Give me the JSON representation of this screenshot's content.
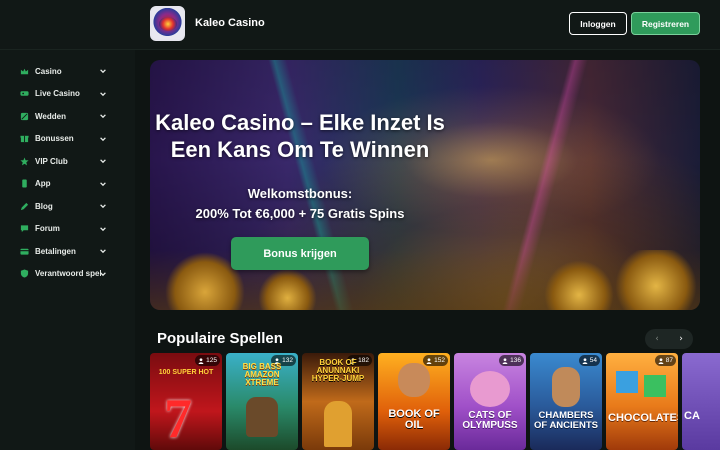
{
  "header": {
    "brand": "Kaleo Casino",
    "login_label": "Inloggen",
    "register_label": "Registreren"
  },
  "sidebar": {
    "items": [
      {
        "label": "Casino",
        "icon": "crown-icon"
      },
      {
        "label": "Live Casino",
        "icon": "live-icon"
      },
      {
        "label": "Wedden",
        "icon": "ball-icon"
      },
      {
        "label": "Bonussen",
        "icon": "gift-icon"
      },
      {
        "label": "VIP Club",
        "icon": "star-icon"
      },
      {
        "label": "App",
        "icon": "phone-icon"
      },
      {
        "label": "Blog",
        "icon": "pen-icon"
      },
      {
        "label": "Forum",
        "icon": "chat-icon"
      },
      {
        "label": "Betalingen",
        "icon": "card-icon"
      },
      {
        "label": "Verantwoord spelen",
        "icon": "shield-icon"
      }
    ]
  },
  "hero": {
    "title_line1": "Kaleo Casino – Elke Inzet Is",
    "title_line2": "Een Kans Om Te Winnen",
    "subtitle_line1": "Welkomstbonus:",
    "subtitle_line2": "200% Tot €6,000 + 75 Gratis Spins",
    "button_label": "Bonus krijgen"
  },
  "popular": {
    "title": "Populaire Spellen",
    "prev": "‹",
    "next": "›",
    "games": [
      {
        "title": "100 SUPER HOT",
        "players": "125",
        "bg": "#b8141a"
      },
      {
        "title": "BIG BASS AMAZON XTREME",
        "players": "132",
        "bg": "#1f8a8a"
      },
      {
        "title": "BOOK OF ANUNNAKI HYPER-JUMP",
        "players": "182",
        "bg": "#c0661a"
      },
      {
        "title": "BOOK OF OIL",
        "players": "152",
        "bg": "#e08a10"
      },
      {
        "title": "CATS OF OLYMPUSS",
        "players": "136",
        "bg": "#b45ad8"
      },
      {
        "title": "CHAMBERS OF ANCIENTS",
        "players": "54",
        "bg": "#2a7ab8"
      },
      {
        "title": "CHOCOLATES",
        "players": "87",
        "bg": "#e07a1a"
      },
      {
        "title": "CA",
        "players": "",
        "bg": "#7a5ab0"
      }
    ]
  }
}
